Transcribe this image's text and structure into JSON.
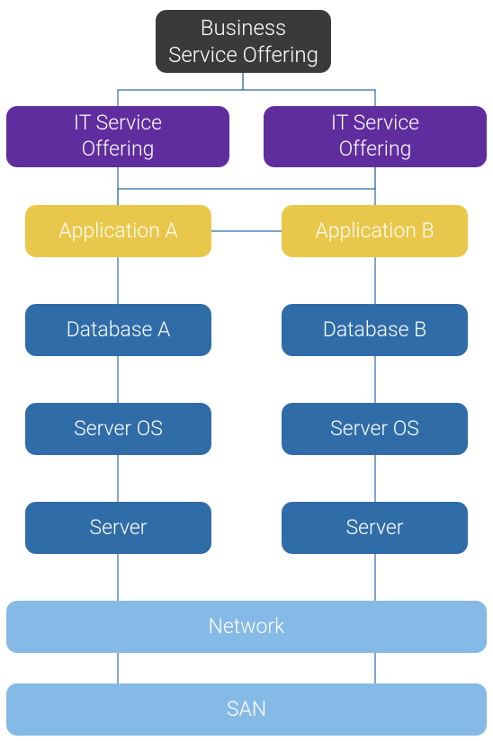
{
  "nodes": {
    "business": "Business\nService Offering",
    "it_left": "IT Service\nOffering",
    "it_right": "IT Service\nOffering",
    "app_a": "Application A",
    "app_b": "Application B",
    "db_a": "Database A",
    "db_b": "Database B",
    "os_a": "Server OS",
    "os_b": "Server OS",
    "srv_a": "Server",
    "srv_b": "Server",
    "network": "Network",
    "san": "SAN"
  },
  "colors": {
    "dark": "#3a3a3a",
    "purple": "#5f2d9e",
    "yellow": "#e9c74a",
    "blue": "#2f6ca8",
    "lightblue": "#85b9e6",
    "line": "#2f6ca8"
  }
}
